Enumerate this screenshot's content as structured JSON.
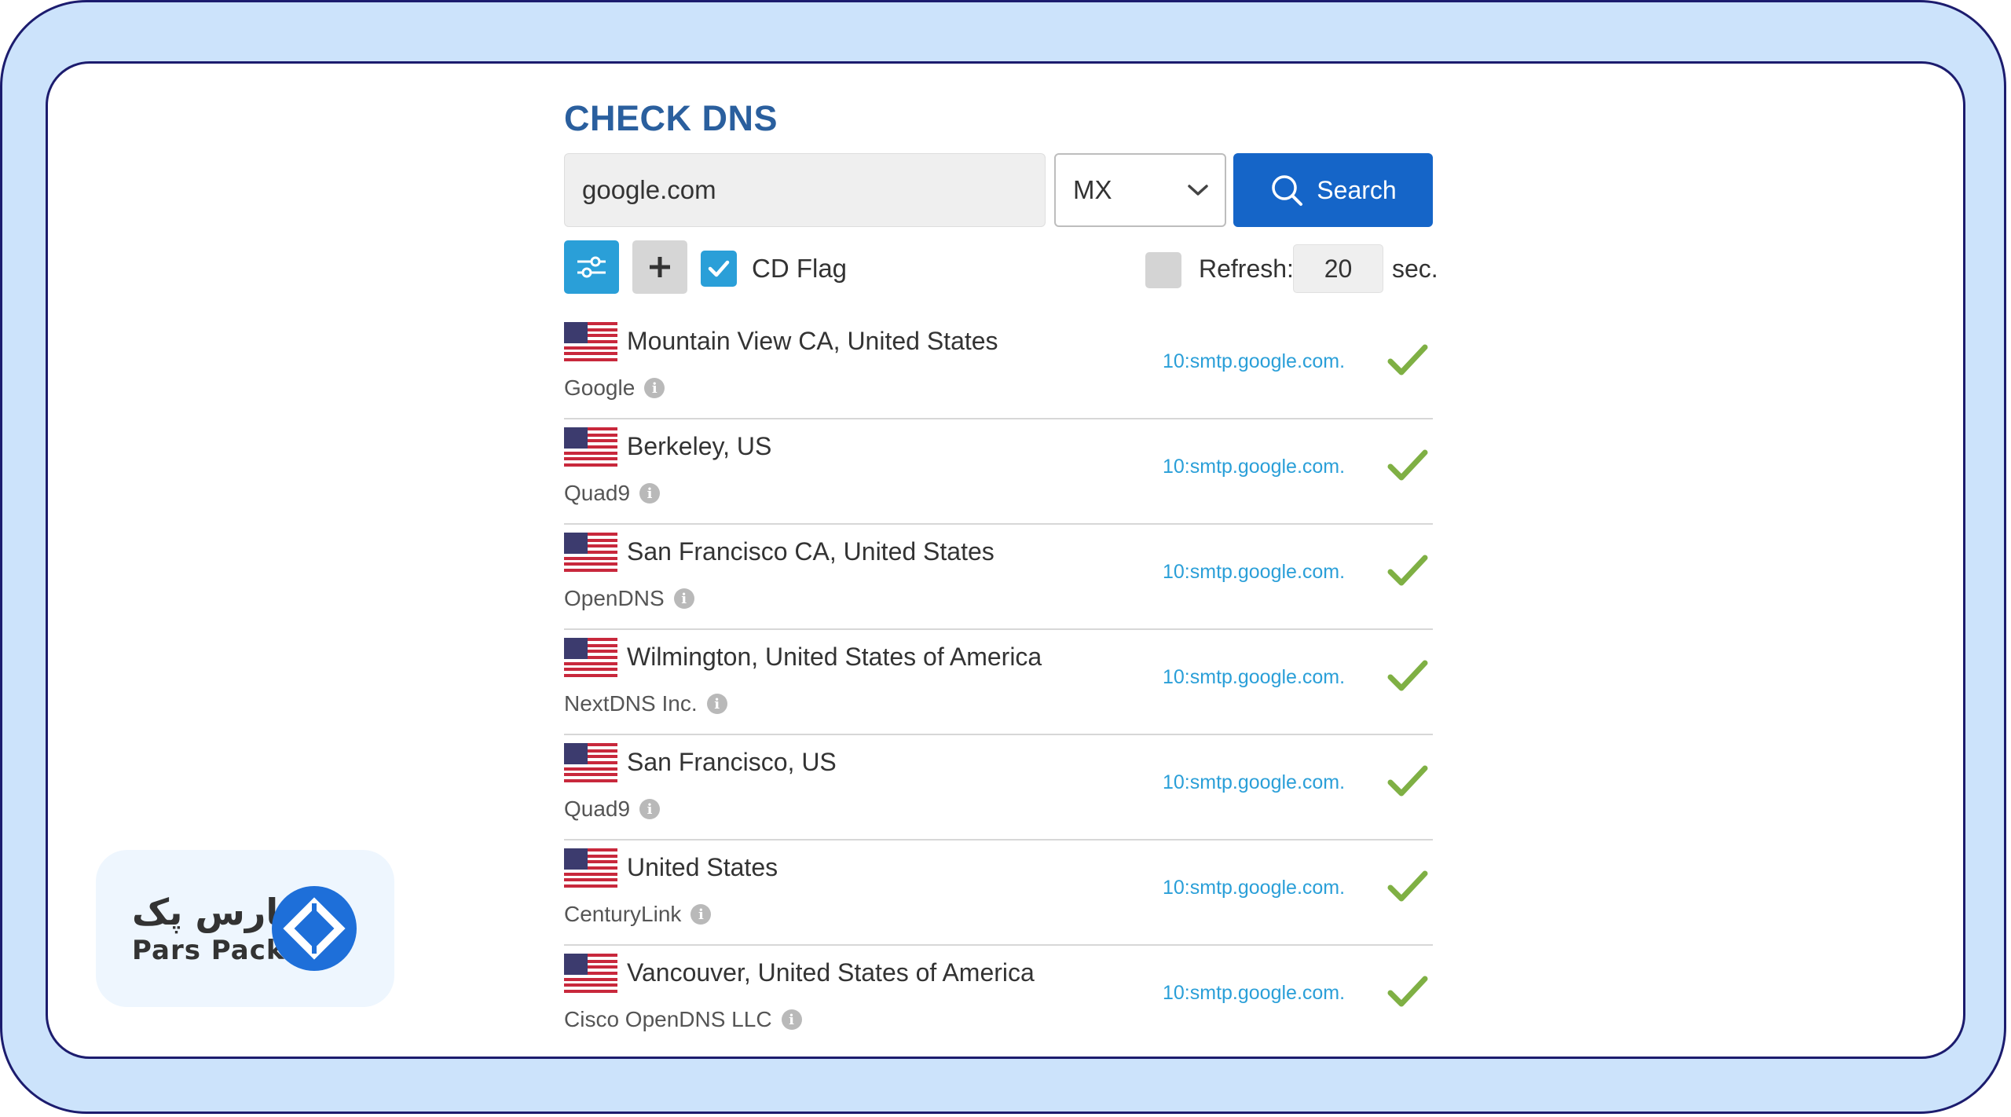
{
  "header": {
    "title": "CHECK DNS"
  },
  "search": {
    "domain_value": "google.com",
    "record_type": "MX",
    "button_label": "Search"
  },
  "options": {
    "cd_flag_label": "CD Flag",
    "cd_flag_checked": true,
    "refresh_checked": false,
    "refresh_label": "Refresh:",
    "refresh_value": "20",
    "refresh_unit": "sec."
  },
  "results": [
    {
      "location": "Mountain View CA, United States",
      "provider": "Google",
      "answer": "10:smtp.google.com.",
      "flag": "us-flag",
      "status": "ok"
    },
    {
      "location": "Berkeley, US",
      "provider": "Quad9",
      "answer": "10:smtp.google.com.",
      "flag": "us-flag",
      "status": "ok"
    },
    {
      "location": "San Francisco CA, United States",
      "provider": "OpenDNS",
      "answer": "10:smtp.google.com.",
      "flag": "us-flag",
      "status": "ok"
    },
    {
      "location": "Wilmington, United States of America",
      "provider": "NextDNS Inc.",
      "answer": "10:smtp.google.com.",
      "flag": "us-flag",
      "status": "ok"
    },
    {
      "location": "San Francisco, US",
      "provider": "Quad9",
      "answer": "10:smtp.google.com.",
      "flag": "us-flag",
      "status": "ok"
    },
    {
      "location": "United States",
      "provider": "CenturyLink",
      "answer": "10:smtp.google.com.",
      "flag": "us-flag",
      "status": "ok"
    },
    {
      "location": "Vancouver, United States of America",
      "provider": "Cisco OpenDNS LLC",
      "answer": "10:smtp.google.com.",
      "flag": "us-flag",
      "status": "ok"
    }
  ],
  "brand": {
    "name_fa": "پارس پک",
    "name_en": "Pars Pack",
    "accent": "#1e6fd9"
  },
  "colors": {
    "frame_bg": "#cce3fb",
    "frame_border": "#1c1c6e",
    "title": "#2a5f9e",
    "primary_button": "#1565c8",
    "accent_blue": "#2a9fd8",
    "check_green": "#7fb044"
  }
}
